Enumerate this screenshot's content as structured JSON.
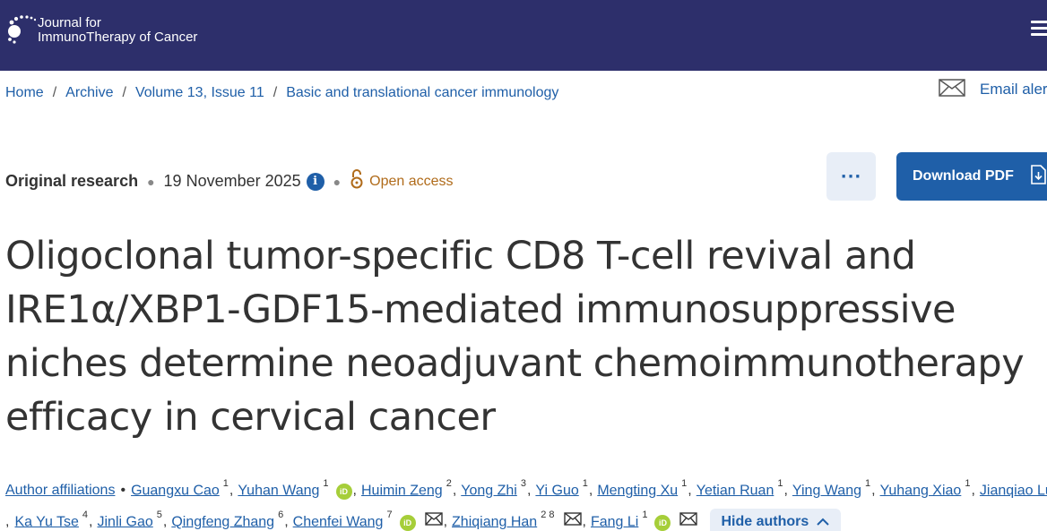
{
  "header": {
    "logo_line1": "Journal for",
    "logo_line2": "ImmunoTherapy of Cancer"
  },
  "breadcrumb": {
    "items": [
      "Home",
      "Archive",
      "Volume 13, Issue 11",
      "Basic and translational cancer immunology"
    ],
    "separator": "/"
  },
  "email_alerts": {
    "label": "Email aler"
  },
  "meta": {
    "article_type": "Original research",
    "date": "19 November 2025",
    "open_access": "Open access"
  },
  "actions": {
    "more_label": "···",
    "download_pdf": "Download PDF"
  },
  "article": {
    "title": "Oligoclonal tumor-specific CD8 T-cell revival and IRE1α/XBP1-GDF15-mediated immunosuppressive niches determine neoadjuvant chemoimmunotherapy efficacy in cervical cancer"
  },
  "authors": {
    "affiliations_label": "Author affiliations",
    "bullet": "•",
    "row1": [
      {
        "name": "Guangxu Cao",
        "sup": "1"
      },
      {
        "name": "Yuhan Wang",
        "sup": "1",
        "orcid": true
      },
      {
        "name": "Huimin Zeng",
        "sup": "2"
      },
      {
        "name": "Yong Zhi",
        "sup": "3"
      },
      {
        "name": "Yi Guo",
        "sup": "1"
      },
      {
        "name": "Mengting Xu",
        "sup": "1"
      },
      {
        "name": "Yetian Ruan",
        "sup": "1"
      },
      {
        "name": "Ying Wang",
        "sup": "1"
      },
      {
        "name": "Yuhang Xiao",
        "sup": "1"
      },
      {
        "name": "Jianqiao Lu",
        "sup": ""
      }
    ],
    "row2": [
      {
        "name": "Ka Yu Tse",
        "sup": "4"
      },
      {
        "name": "Jinli Gao",
        "sup": "5"
      },
      {
        "name": "Qingfeng Zhang",
        "sup": "6"
      },
      {
        "name": "Chenfei Wang",
        "sup": "7",
        "orcid": true,
        "mail": true
      },
      {
        "name": "Zhiqiang Han",
        "sup": "2 8",
        "mail": true
      },
      {
        "name": "Fang Li",
        "sup": "1",
        "orcid": true,
        "mail": true
      }
    ],
    "orcid_text": "iD",
    "hide_label": "Hide authors"
  },
  "colors": {
    "header_bg": "#2d2f6b",
    "link": "#1f5fa8",
    "open_access": "#b06b1a",
    "orcid": "#a6ce39",
    "button_light": "#e8eef7"
  },
  "icons": [
    "logo-dots-icon",
    "hamburger-menu-icon",
    "envelope-icon",
    "info-icon",
    "open-access-lock-icon",
    "download-file-icon",
    "orcid-icon",
    "mail-icon",
    "chevron-up-icon"
  ]
}
